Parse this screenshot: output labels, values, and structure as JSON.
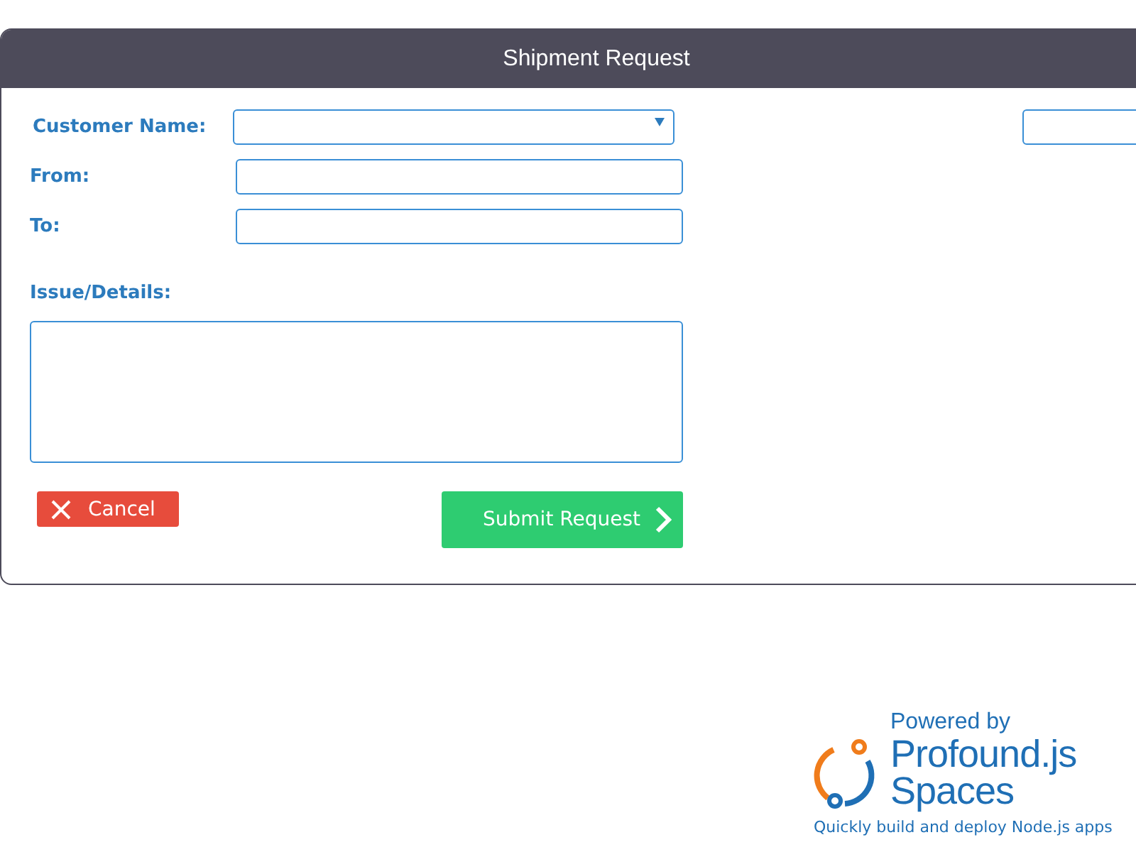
{
  "window": {
    "title": "Shipment Request"
  },
  "fields": [
    {
      "kind": "select",
      "label": "Customer Name:"
    },
    {
      "kind": "text",
      "label": "From:"
    },
    {
      "kind": "text",
      "label": "To:"
    }
  ],
  "details": {
    "label": "Issue/Details:"
  },
  "buttons": {
    "cancel": "Cancel",
    "submit": "Submit Request"
  },
  "footer": {
    "powered_by": "Powered by",
    "brand_line_1": "Profound.js",
    "brand_line_2": "Spaces",
    "tagline": "Quickly build and deploy Node.js apps"
  }
}
